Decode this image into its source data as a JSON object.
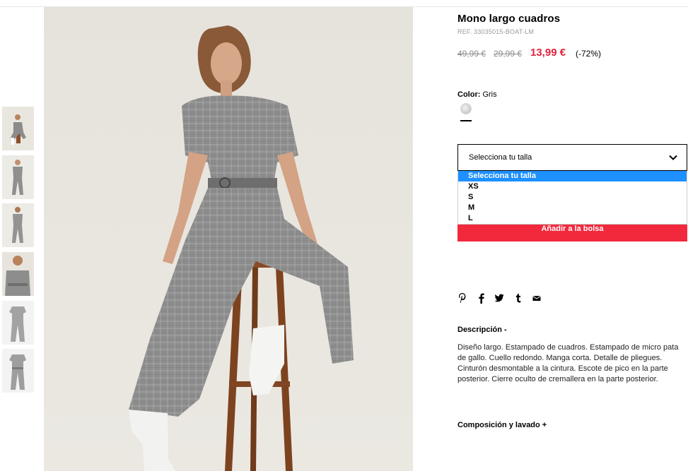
{
  "product": {
    "title": "Mono largo cuadros",
    "ref": "REF. 33035015-BOAT-LM",
    "price_original_1": "49,99 €",
    "price_original_2": "29,99 €",
    "price_current": "13,99 €",
    "discount": "(-72%)"
  },
  "color": {
    "label": "Color:",
    "value": "Gris",
    "swatch_icon": "color-swatch-gris"
  },
  "size_select": {
    "selected_label": "Selecciona tu talla",
    "options": [
      "Selecciona tu talla",
      "XS",
      "S",
      "M",
      "L"
    ],
    "highlight_color": "#1e90ff"
  },
  "add_to_bag": {
    "label": "Añadir a la bolsa",
    "color": "#f2293d"
  },
  "share_icons": [
    "pinterest-icon",
    "facebook-icon",
    "twitter-icon",
    "tumblr-icon",
    "email-icon"
  ],
  "description": {
    "title": "Descripción -",
    "text": "Diseño largo. Estampado de cuadros. Estampado de micro pata de gallo. Cuello redondo. Manga corta. Detalle de pliegues. Cinturón desmontable a la cintura. Escote de pico en la parte posterior. Cierre oculto de cremallera en la parte posterior."
  },
  "composition": {
    "title": "Composición y lavado +"
  },
  "colors": {
    "sale_price": "#e1223a",
    "background": "#ffffff"
  }
}
